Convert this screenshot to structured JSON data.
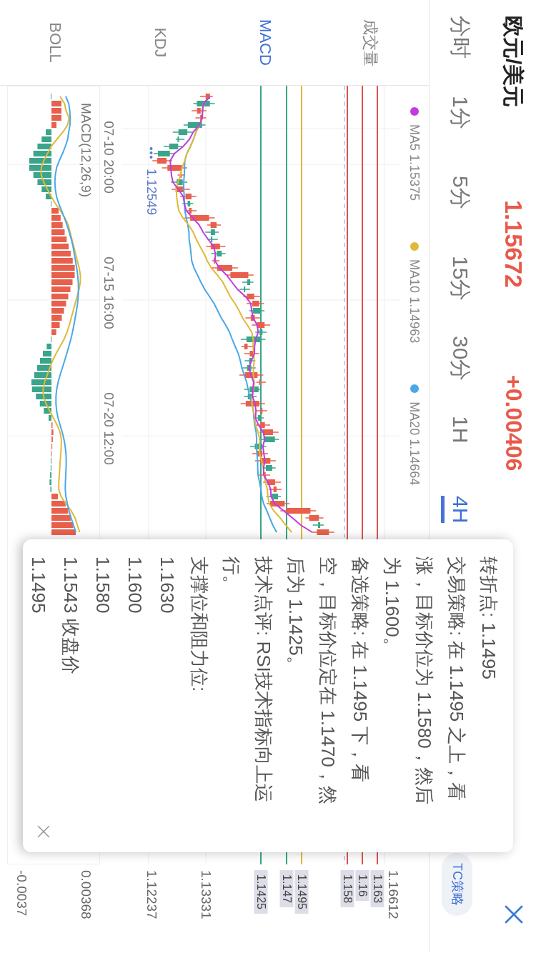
{
  "header": {
    "title": "欧元/美元",
    "price": "1.15672",
    "change": "+0.00406"
  },
  "periods": [
    {
      "label": "分时",
      "selected": false
    },
    {
      "label": "1分",
      "selected": false
    },
    {
      "label": "5分",
      "selected": false
    },
    {
      "label": "15分",
      "selected": false
    },
    {
      "label": "30分",
      "selected": false
    },
    {
      "label": "1H",
      "selected": false
    },
    {
      "label": "4H",
      "selected": true
    }
  ],
  "strategy_button": "TC策略",
  "indicators": [
    {
      "label": "成交量",
      "selected": false
    },
    {
      "label": "MACD",
      "selected": true
    },
    {
      "label": "KDJ",
      "selected": false
    },
    {
      "label": "BOLL",
      "selected": false
    }
  ],
  "chart": {
    "legend": [
      {
        "name": "MA5",
        "value": "1.15375",
        "color": "#c03ce0"
      },
      {
        "name": "MA10",
        "value": "1.14963",
        "color": "#e0b93a"
      },
      {
        "name": "MA20",
        "value": "1.14664",
        "color": "#4aa8e8"
      }
    ],
    "low_label": "1.12549",
    "time_labels": [
      "07-10 20:00",
      "07-15 16:00",
      "07-20 12:00"
    ],
    "price_axis": [
      "1.16612",
      "1.13331",
      "1.12237"
    ],
    "levels": [
      {
        "label": "1.163",
        "color": "#d9534f"
      },
      {
        "label": "1.16",
        "color": "#d9534f"
      },
      {
        "label": "1.158",
        "color": "#d9534f"
      },
      {
        "label": "1.1495",
        "color": "#e0b93a"
      },
      {
        "label": "1.147",
        "color": "#3aa58a"
      },
      {
        "label": "1.1425",
        "color": "#3aa58a"
      }
    ]
  },
  "macd": {
    "title": "MACD(12,26,9)",
    "axis": [
      "0.00368",
      "-0.0037"
    ]
  },
  "popup": {
    "lines": [
      "转折点: 1.1495",
      "交易策略: 在 1.1495 之上，看涨，目标价位为 1.1580，然后为 1.1600。",
      "备选策略: 在 1.1495 下，看空，目标价位定在 1.1470，然后为 1.1425。",
      "技术点评: RSI技术指标向上运行。",
      "支撑位和阻力位:"
    ],
    "levels": [
      "1.1630",
      "1.1600",
      "1.1580",
      "1.1543 收盘价",
      "1.1495"
    ]
  }
}
